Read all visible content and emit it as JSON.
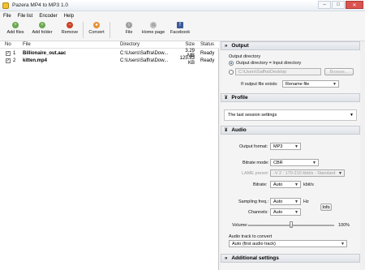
{
  "window": {
    "title": "Pazera MP4 to MP3 1.0",
    "min": "–",
    "max": "□",
    "close": "✕"
  },
  "menu": [
    "File",
    "File list",
    "Encoder",
    "Help"
  ],
  "toolbar": {
    "add_files": "Add files",
    "add_folder": "Add folder",
    "remove": "Remove",
    "convert": "Convert",
    "file": "File",
    "home_page": "Home page",
    "facebook": "Facebook"
  },
  "filelist": {
    "headers": {
      "no": "No",
      "file": "File",
      "directory": "Directory",
      "size": "Size",
      "status": "Status"
    },
    "rows": [
      {
        "no": "1",
        "file": "Billionaire_out.aac",
        "directory": "C:\\Users\\Saffra\\Dow...",
        "size": "3.29 MB",
        "status": "Ready"
      },
      {
        "no": "2",
        "file": "kitten.mp4",
        "directory": "C:\\Users\\Saffra\\Dow...",
        "size": "125.83 KB",
        "status": "Ready"
      }
    ]
  },
  "output": {
    "header": "Output",
    "dir_label": "Output directory",
    "radio1": "Output directory = Input directory",
    "path": "C:\\Users\\Saffra\\Desktop",
    "browse": "Browse...",
    "exists_label": "If output file exists:",
    "exists_value": "Rename file"
  },
  "profile": {
    "header": "Profile",
    "value": "The last session settings"
  },
  "audio": {
    "header": "Audio",
    "format_label": "Output format:",
    "format_value": "MP3",
    "bitrate_mode_label": "Bitrate mode:",
    "bitrate_mode_value": "CBR",
    "lame_label": "LAME preset:",
    "lame_value": "-V 2 : 170-210 kbit/s - Standard",
    "bitrate_label": "Bitrate:",
    "bitrate_value": "Auto",
    "bitrate_unit": "kbit/s",
    "sampling_label": "Sampling freq.:",
    "sampling_value": "Auto",
    "sampling_unit": "Hz",
    "channels_label": "Channels:",
    "channels_value": "Auto",
    "info": "Info",
    "volume_label": "Volume:",
    "volume_value": "100%",
    "volume_level": 1.0,
    "track_label": "Audio track to convert",
    "track_value": "Auto (first audio track)"
  },
  "additional": {
    "header": "Additional settings"
  }
}
